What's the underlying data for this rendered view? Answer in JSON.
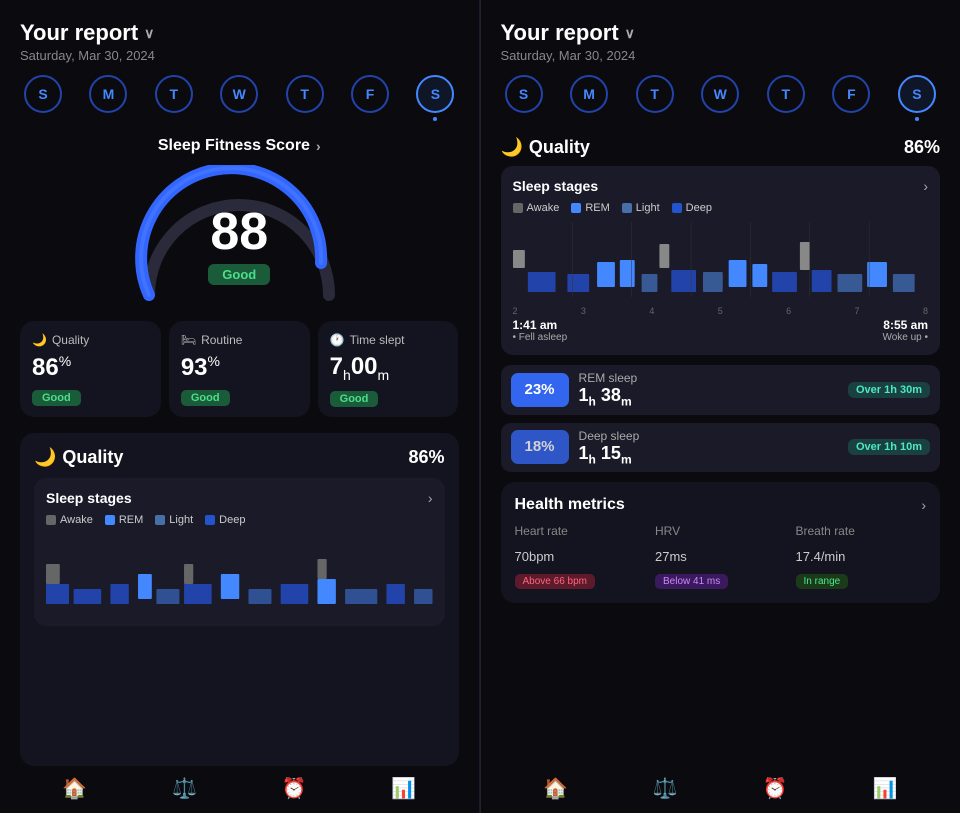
{
  "left": {
    "title": "Your report",
    "chevron": "∨",
    "date": "Saturday, Mar 30, 2024",
    "days": [
      {
        "label": "S",
        "active": false,
        "dot": false
      },
      {
        "label": "M",
        "active": false,
        "dot": false
      },
      {
        "label": "T",
        "active": false,
        "dot": false
      },
      {
        "label": "W",
        "active": false,
        "dot": false
      },
      {
        "label": "T",
        "active": false,
        "dot": false
      },
      {
        "label": "F",
        "active": false,
        "dot": false
      },
      {
        "label": "S",
        "active": true,
        "dot": true
      }
    ],
    "fitness_score_label": "Sleep Fitness Score",
    "fitness_score_arrow": "›",
    "score": "88",
    "score_badge": "Good",
    "metrics": [
      {
        "icon": "🌙",
        "title": "Quality",
        "value": "86",
        "unit": "%",
        "badge": "Good"
      },
      {
        "icon": "🛏",
        "title": "Routine",
        "value": "93",
        "unit": "%",
        "badge": "Good"
      },
      {
        "icon": "🕐",
        "title": "Time slept",
        "value": "7",
        "unit_h": "h",
        "value2": "00",
        "unit_m": "m",
        "badge": "Good"
      }
    ],
    "quality_section": {
      "icon": "🌙",
      "title": "Quality",
      "percent": "86%",
      "sleep_stages": {
        "title": "Sleep stages",
        "arrow": "›",
        "legend": [
          {
            "label": "Awake",
            "class": "awake"
          },
          {
            "label": "REM",
            "class": "rem"
          },
          {
            "label": "Light",
            "class": "light"
          },
          {
            "label": "Deep",
            "class": "deep"
          }
        ]
      }
    }
  },
  "right": {
    "title": "Your report",
    "chevron": "∨",
    "date": "Saturday, Mar 30, 2024",
    "days": [
      {
        "label": "S",
        "active": false,
        "dot": false
      },
      {
        "label": "M",
        "active": false,
        "dot": false
      },
      {
        "label": "T",
        "active": false,
        "dot": false
      },
      {
        "label": "W",
        "active": false,
        "dot": false
      },
      {
        "label": "T",
        "active": false,
        "dot": false
      },
      {
        "label": "F",
        "active": false,
        "dot": false
      },
      {
        "label": "S",
        "active": true,
        "dot": true
      }
    ],
    "quality_section": {
      "icon": "🌙",
      "title": "Quality",
      "percent": "86%",
      "sleep_stages": {
        "title": "Sleep stages",
        "arrow": "›",
        "legend": [
          {
            "label": "Awake",
            "class": "awake"
          },
          {
            "label": "REM",
            "class": "rem"
          },
          {
            "label": "Light",
            "class": "light"
          },
          {
            "label": "Deep",
            "class": "deep"
          }
        ],
        "times": [
          "2",
          "3",
          "4",
          "5",
          "6",
          "7",
          "8"
        ],
        "fell_asleep_time": "1:41 am",
        "fell_asleep_label": "• Fell asleep",
        "woke_up_time": "8:55 am",
        "woke_up_label": "Woke up •"
      },
      "rem_sleep": {
        "label": "REM sleep",
        "percent": "23%",
        "hours": "1",
        "mins": "38",
        "badge": "Over 1h 30m"
      },
      "deep_sleep": {
        "label": "Deep sleep",
        "percent": "18%",
        "hours": "1",
        "mins": "15",
        "badge": "Over 1h 10m"
      }
    },
    "health_metrics": {
      "title": "Health metrics",
      "arrow": "›",
      "items": [
        {
          "name": "Heart rate",
          "value": "70",
          "unit": "bpm",
          "badge": "Above 66 bpm",
          "badge_type": "red"
        },
        {
          "name": "HRV",
          "value": "27",
          "unit": "ms",
          "badge": "Below 41 ms",
          "badge_type": "purple"
        },
        {
          "name": "Breath rate",
          "value": "17.4",
          "unit": "/min",
          "badge": "In range",
          "badge_type": "green"
        }
      ]
    },
    "nav": [
      {
        "icon": "🏠",
        "label": "",
        "active": false
      },
      {
        "icon": "🌡",
        "label": "",
        "active": false
      },
      {
        "icon": "⏰",
        "label": "",
        "active": false
      },
      {
        "icon": "📊",
        "label": "",
        "active": true
      }
    ]
  },
  "nav": [
    {
      "icon": "🏠",
      "active": false
    },
    {
      "icon": "🌡",
      "active": false
    },
    {
      "icon": "⏰",
      "active": false
    },
    {
      "icon": "📊",
      "active": true
    }
  ]
}
